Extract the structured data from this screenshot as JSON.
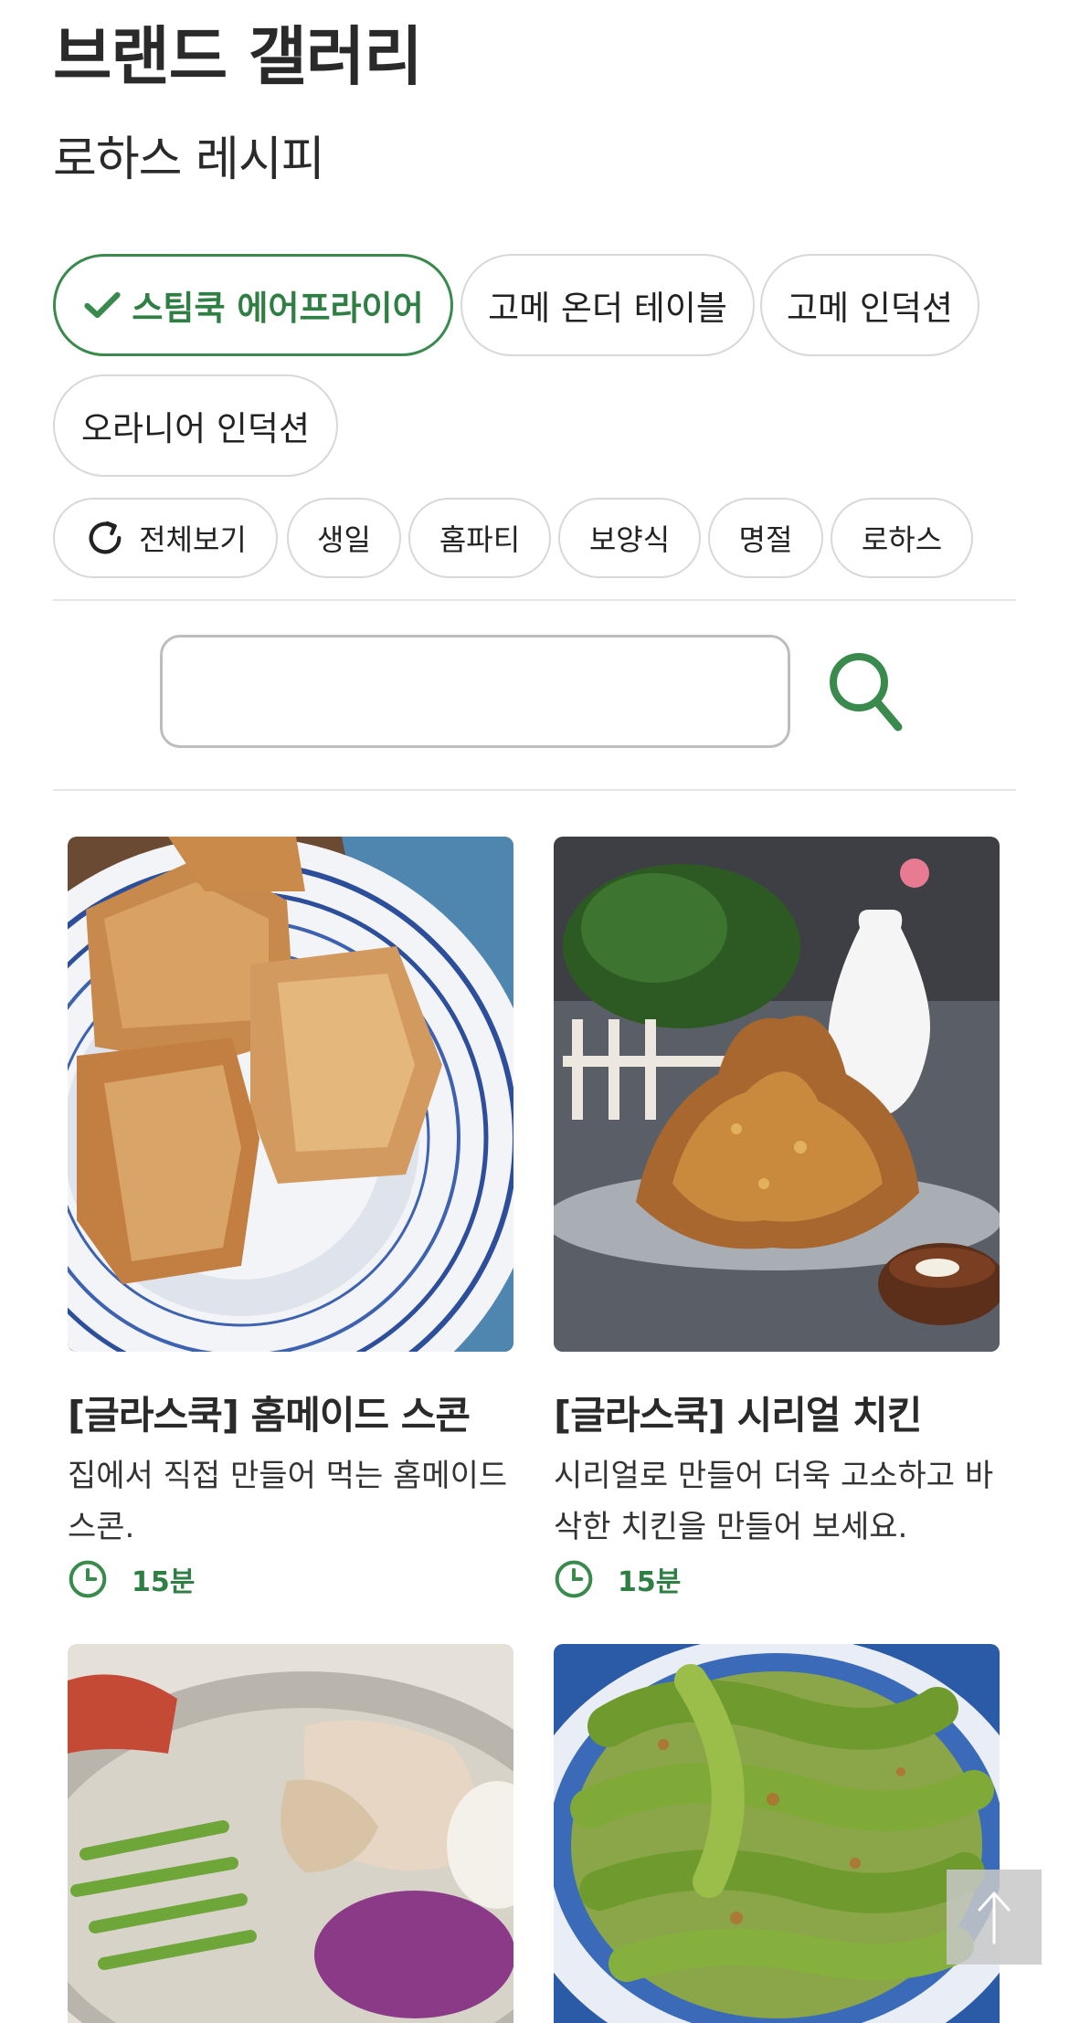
{
  "header": {
    "brand_title": "브랜드 갤러리",
    "sub_title": "로하스 레시피"
  },
  "product_tabs": [
    {
      "label": "스팀쿡 에어프라이어",
      "active": true
    },
    {
      "label": "고메 온더 테이블",
      "active": false
    },
    {
      "label": "고메 인덕션",
      "active": false
    },
    {
      "label": "오라니어 인덕션",
      "active": false
    }
  ],
  "categories": [
    {
      "label": "전체보기",
      "icon": "refresh-icon"
    },
    {
      "label": "생일"
    },
    {
      "label": "홈파티"
    },
    {
      "label": "보양식"
    },
    {
      "label": "명절"
    },
    {
      "label": "로하스"
    }
  ],
  "search": {
    "value": "",
    "placeholder": "",
    "icon": "search-icon"
  },
  "recipes": [
    {
      "title": "[글라스쿡] 홈메이드 스콘",
      "description": "집에서 직접 만들어 먹는 홈메이드 스콘.",
      "time": "15분",
      "image": "scones-photo"
    },
    {
      "title": "[글라스쿡] 시리얼 치킨",
      "description": "시리얼로 만들어 더욱 고소하고 바삭한 치킨을 만들어 보세요.",
      "time": "15분",
      "image": "cereal-chicken-photo"
    },
    {
      "image": "chicken-noodle-photo"
    },
    {
      "image": "pepper-side-dish-photo"
    }
  ],
  "colors": {
    "accent": "#3a8a4e",
    "border": "#d8d8d8",
    "divider": "#e6e6e6"
  },
  "scroll_top": {
    "icon": "arrow-up-icon"
  }
}
